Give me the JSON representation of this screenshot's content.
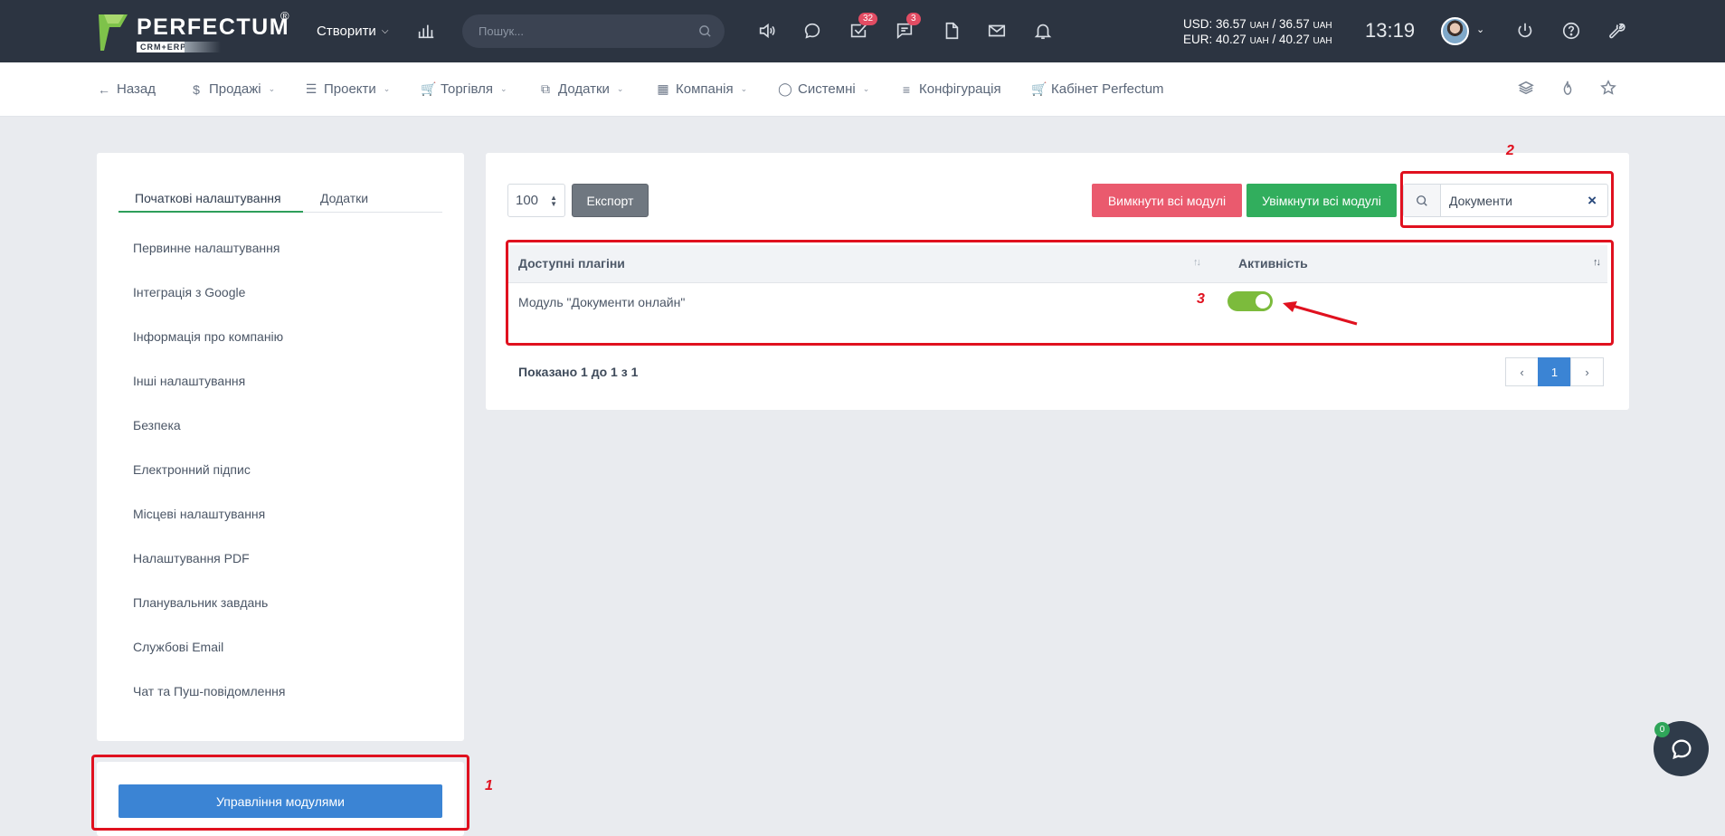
{
  "app": {
    "logo_text": "PERFECTUM",
    "logo_reg": "®",
    "logo_sub": "CRM+ERP"
  },
  "topbar": {
    "create_label": "Створити",
    "search_placeholder": "Пошук...",
    "tasks_badge": "32",
    "messages_badge": "3",
    "usd_line": "USD: 36.57",
    "usd_rate2": "36.57",
    "eur_line": "EUR: 40.27",
    "eur_rate2": "40.27",
    "currency_unit": "UAH",
    "time": "13:19"
  },
  "subnav": {
    "back": "Назад",
    "sales": "Продажі",
    "projects": "Проекти",
    "trade": "Торгівля",
    "addons": "Додатки",
    "company": "Компанія",
    "system": "Системні",
    "config": "Конфігурація",
    "cabinet": "Кабінет Perfectum"
  },
  "left": {
    "tab_initial": "Початкові налаштування",
    "tab_addons": "Додатки",
    "items": [
      "Первинне налаштування",
      "Інтеграція з Google",
      "Інформація про компанію",
      "Інші налаштування",
      "Безпека",
      "Електронний підпис",
      "Місцеві налаштування",
      "Налаштування PDF",
      "Планувальник завдань",
      "Службові Email",
      "Чат та Пуш-повідомлення"
    ],
    "modules_button": "Управління модулями"
  },
  "main": {
    "page_size": "100",
    "export_label": "Експорт",
    "disable_all": "Вимкнути всі модулі",
    "enable_all": "Увімкнути всі модулі",
    "filter_value": "Документи",
    "columns": [
      "Доступні плагіни",
      "Активність"
    ],
    "rows": [
      {
        "name": "Модуль \"Документи онлайн\"",
        "active": true
      }
    ],
    "shown_text": "Показано 1 до 1 з 1",
    "pager": {
      "prev": "‹",
      "current": "1",
      "next": "›"
    }
  },
  "annotations": {
    "num1": "1",
    "num2": "2",
    "num3": "3"
  },
  "chat": {
    "badge": "0"
  },
  "colors": {
    "topbar_bg": "#2c3441",
    "accent_blue": "#3b84d4",
    "danger": "#ea5a6e",
    "success": "#31ae5d",
    "toggle_on": "#7cbb3c",
    "annotation_red": "#e0111f"
  }
}
